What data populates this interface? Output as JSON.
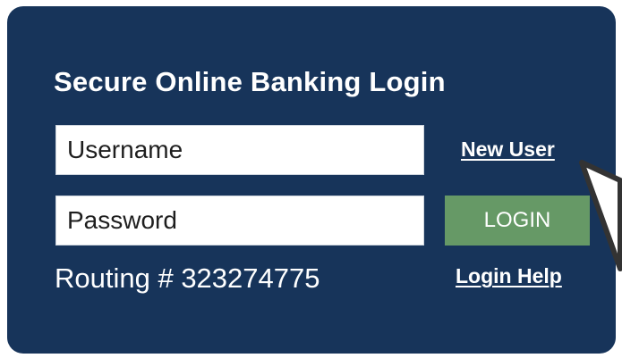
{
  "login_panel": {
    "title": "Secure Online Banking Login",
    "username": {
      "placeholder": "Username"
    },
    "password": {
      "placeholder": "Password"
    },
    "new_user_link": "New User",
    "login_button": "LOGIN",
    "routing_text": "Routing # 323274775",
    "login_help_link": "Login Help"
  },
  "colors": {
    "panel_background": "#17345a",
    "button_green": "#669966",
    "text_white": "#ffffff"
  },
  "icons": {
    "cursor": "mouse-pointer-icon"
  }
}
